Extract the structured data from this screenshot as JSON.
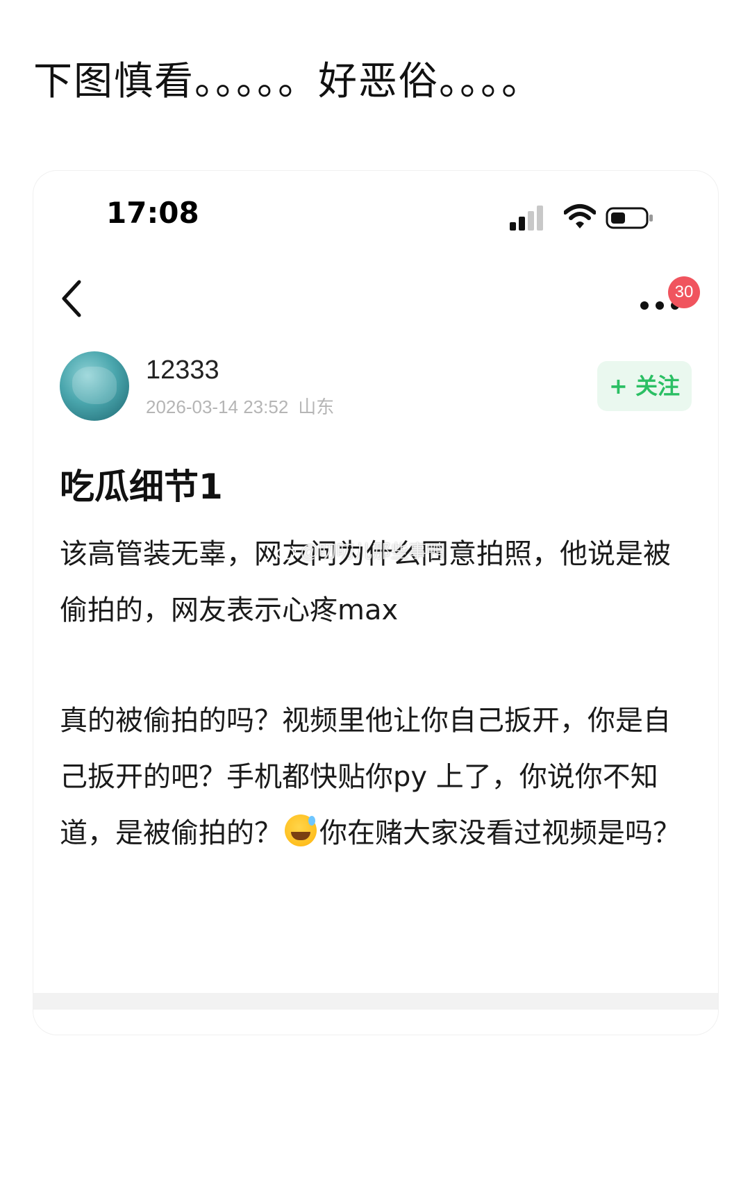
{
  "caption": "下图慎看。。。。。好恶俗。。。。",
  "status_bar": {
    "time": "17:08",
    "icons": [
      "signal-icon",
      "wifi-icon",
      "battery-icon"
    ]
  },
  "nav": {
    "back_icon": "chevron-left-icon",
    "more_icon": "more-dots-icon",
    "badge_count": "30"
  },
  "author": {
    "name": "12333",
    "datetime": "2026-03-14 23:52",
    "location": "山东",
    "follow_label": "+ 关注"
  },
  "post": {
    "title": "吃瓜细节1",
    "paragraph_1": "该高管装无辜，网友问为什么同意拍照，他说是被偷拍的，网友表示心疼max",
    "paragraph_2_before_emoji": "真的被偷拍的吗？视频里他让你自己扳开，你是自己扳开的吧？手机都快贴你py 上了，你说你不知道，是被偷拍的？",
    "paragraph_2_after_emoji": "你在赌大家没看过视频是吗？",
    "emoji_name": "grinning-sweat-emoji"
  },
  "watermark": "@叨叨儿那些事鸭",
  "colors": {
    "follow_text": "#2bbf64",
    "follow_bg": "#eaf8ef",
    "badge": "#f0545e",
    "meta_text": "#b5b5b5"
  }
}
